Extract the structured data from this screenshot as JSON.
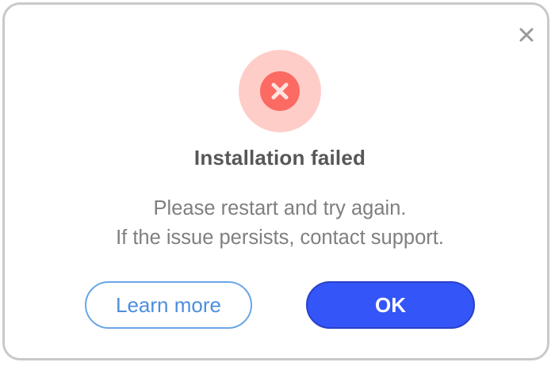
{
  "dialog": {
    "title": "Installation failed",
    "message_lines": [
      "Please restart and try again.",
      "If the issue persists, contact support."
    ],
    "status_icon": "error-x-icon",
    "close_icon": "close-icon"
  },
  "buttons": {
    "secondary_label": "Learn more",
    "primary_label": "OK"
  },
  "colors": {
    "error_halo": "#ffcdc8",
    "error_core": "#fb6a63",
    "primary": "#3455f7",
    "secondary_text": "#4c8fdd",
    "title_text": "#575757",
    "body_text": "#7f7f7f"
  }
}
